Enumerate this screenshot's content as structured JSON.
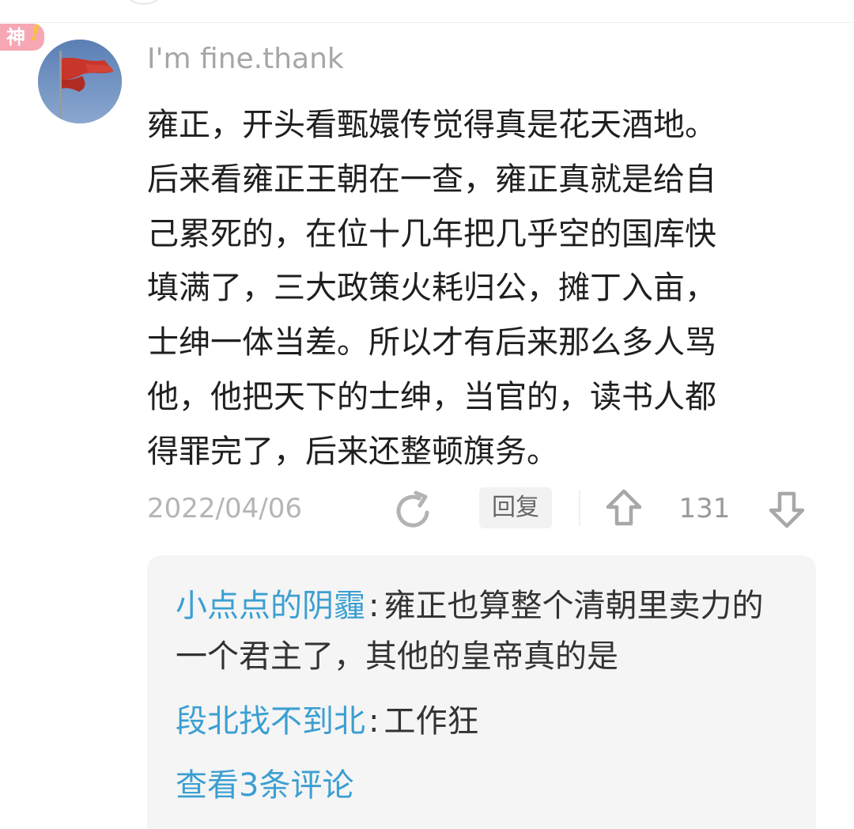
{
  "badge": {
    "text": "神",
    "mark": "!"
  },
  "comment": {
    "username": "I'm fine.thank",
    "avatar_icon": "red-flag-avatar-icon",
    "text": "雍正，开头看甄嬛传觉得真是花天酒地。\n后来看雍正王朝在一查，雍正真就是给自\n己累死的，在位十几年把几乎空的国库快\n填满了，三大政策火耗归公，摊丁入亩，\n士绅一体当差。所以才有后来那么多人骂\n他，他把天下的士绅，当官的，读书人都\n得罪完了，后来还整顿旗务。",
    "date": "2022/04/06",
    "reply_label": "回复",
    "vote_count": "131",
    "icons": {
      "share": "share-icon",
      "upvote": "upvote-icon",
      "downvote": "downvote-icon"
    }
  },
  "replies": {
    "items": [
      {
        "author": "小点点的阴霾",
        "separator": ":",
        "text": "雍正也算整个清朝里卖力的一个君主了，其他的皇帝真的是"
      },
      {
        "author": "段北找不到北",
        "separator": ":",
        "text": "工作狂"
      }
    ],
    "view_more": "查看3条评论"
  },
  "colors": {
    "link": "#3b9fd1",
    "badge": "#f6a7b3",
    "badge_mark": "#f7c23b",
    "meta": "#b5b5b5",
    "reply_bg": "#f5f5f5"
  }
}
